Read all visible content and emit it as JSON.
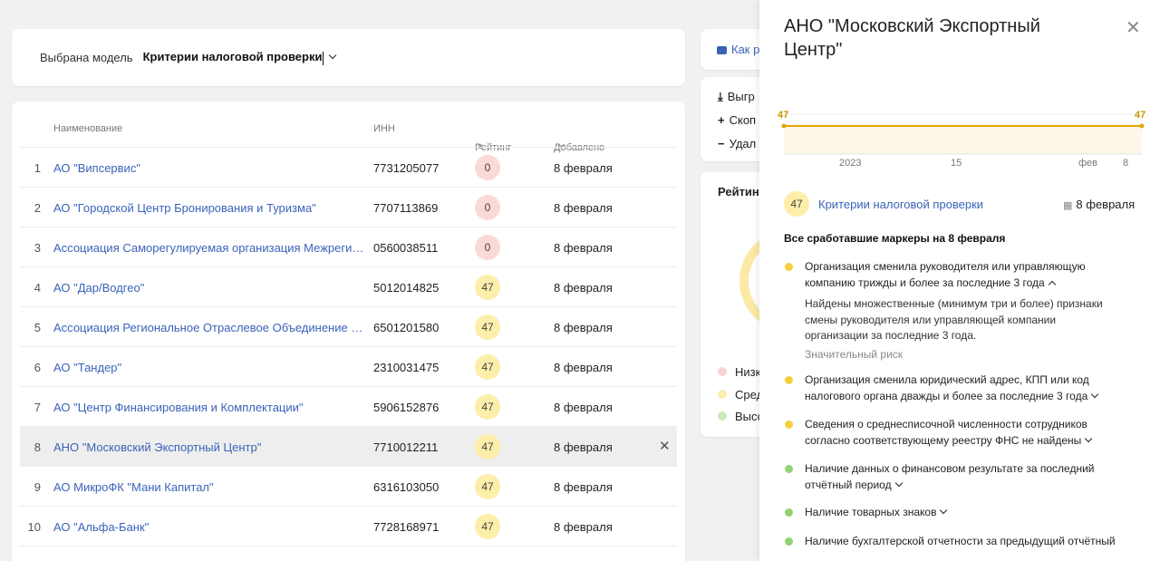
{
  "model_selector": {
    "label": "Выбрана модель",
    "value": "Критерии налоговой проверки"
  },
  "table": {
    "columns": {
      "name": "Наименование",
      "inn": "ИНН",
      "rating": "Рейтинг",
      "added": "Добавлено"
    },
    "rows": [
      {
        "num": "1",
        "name": "АО \"Випсервис\"",
        "inn": "7731205077",
        "rating": "0",
        "level": "red",
        "date": "8 февраля"
      },
      {
        "num": "2",
        "name": "АО \"Городской Центр Бронирования и Туризма\"",
        "inn": "7707113869",
        "rating": "0",
        "level": "red",
        "date": "8 февраля"
      },
      {
        "num": "3",
        "name": "Ассоциация Саморегулируемая организация Межрегиональная",
        "inn": "0560038511",
        "rating": "0",
        "level": "red",
        "date": "8 февраля"
      },
      {
        "num": "4",
        "name": "АО \"Дар/Водгео\"",
        "inn": "5012014825",
        "rating": "47",
        "level": "yellow",
        "date": "8 февраля"
      },
      {
        "num": "5",
        "name": "Ассоциация Региональное Отраслевое Объединение Работодателей",
        "inn": "6501201580",
        "rating": "47",
        "level": "yellow",
        "date": "8 февраля"
      },
      {
        "num": "6",
        "name": "АО \"Тандер\"",
        "inn": "2310031475",
        "rating": "47",
        "level": "yellow",
        "date": "8 февраля"
      },
      {
        "num": "7",
        "name": "АО \"Центр Финансирования и Комплектации\"",
        "inn": "5906152876",
        "rating": "47",
        "level": "yellow",
        "date": "8 февраля"
      },
      {
        "num": "8",
        "name": "АНО \"Московский Экспортный Центр\"",
        "inn": "7710012211",
        "rating": "47",
        "level": "yellow",
        "date": "8 февраля",
        "selected": true
      },
      {
        "num": "9",
        "name": "АО МикроФК \"Мани Капитал\"",
        "inn": "6316103050",
        "rating": "47",
        "level": "yellow",
        "date": "8 февраля"
      },
      {
        "num": "10",
        "name": "АО \"Альфа-Банк\"",
        "inn": "7728168971",
        "rating": "47",
        "level": "yellow",
        "date": "8 февраля"
      }
    ]
  },
  "side_cards": {
    "how_to": "Как р",
    "export": "Выгр",
    "copy": "Скоп",
    "delete": "Удал",
    "rating_title": "Рейтин",
    "legend": [
      "Низк",
      "Сред",
      "Высо"
    ]
  },
  "panel": {
    "title": "АНО \"Московский Экспортный Центр\"",
    "chart": {
      "start_value": "47",
      "end_value": "47",
      "ticks": [
        "2023",
        "15",
        "фев",
        "8"
      ]
    },
    "model": {
      "score": "47",
      "name": "Критерии налоговой проверки",
      "date": "8 февраля"
    },
    "markers_title": "Все сработавшие маркеры на 8 февраля",
    "markers": [
      {
        "text": "Организация сменила руководителя или управляющую компанию трижды и более за последние 3 года",
        "description": "Найдены множественные (минимум три и более) признаки смены руководителя или управляющей компании организации за последние 3 года.",
        "risk": "Значительный риск"
      },
      {
        "text": "Организация сменила юридический адрес, КПП или код налогового органа дважды и более за последние 3 года"
      },
      {
        "text": "Сведения о среднесписочной численности сотрудников согласно соответствующему реестру ФНС не найдены"
      },
      {
        "text": "Наличие данных о финансовом результате за последний отчётный период"
      },
      {
        "text": "Наличие товарных знаков"
      },
      {
        "text": "Наличие бухгалтерской отчетности за предыдущий отчётный"
      }
    ]
  },
  "colors": {
    "link": "#3a63b8",
    "rating_low": "#fbd9d6",
    "rating_mid": "#fdeeaa",
    "marker_yellow": "#f5cf3c",
    "marker_green": "#93d174",
    "chart_line": "#e0a800"
  }
}
